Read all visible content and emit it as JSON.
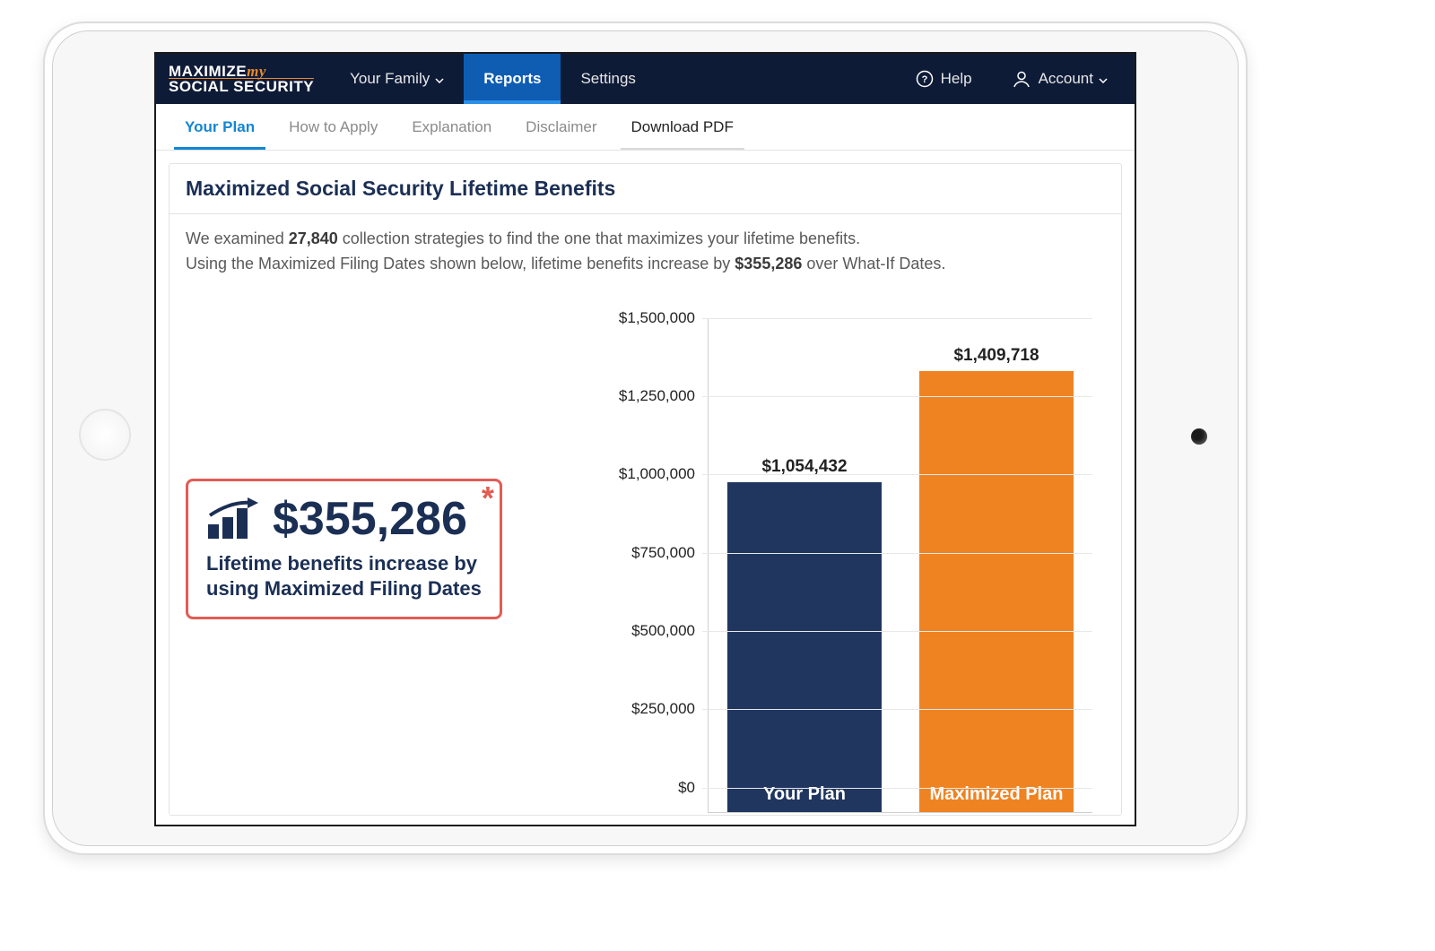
{
  "brand": {
    "maximize": "MAXIMIZE",
    "my": "my",
    "line2": "SOCIAL SECURITY"
  },
  "nav": {
    "your_family": "Your Family",
    "reports": "Reports",
    "settings": "Settings",
    "help": "Help",
    "account": "Account"
  },
  "subtabs": {
    "your_plan": "Your Plan",
    "how_to_apply": "How to Apply",
    "explanation": "Explanation",
    "disclaimer": "Disclaimer",
    "download_pdf": "Download PDF"
  },
  "panel": {
    "title": "Maximized Social Security Lifetime Benefits",
    "summary_1a": "We examined ",
    "summary_1b": "27,840",
    "summary_1c": " collection strategies to find the one that maximizes your lifetime benefits.",
    "summary_2a": "Using the Maximized Filing Dates shown below, lifetime benefits increase by ",
    "summary_2b": "$355,286",
    "summary_2c": " over What-If Dates."
  },
  "callout": {
    "amount": "$355,286",
    "line1": "Lifetime benefits increase by",
    "line2": "using Maximized Filing Dates"
  },
  "chart_data": {
    "type": "bar",
    "categories": [
      "Your Plan",
      "Maximized Plan"
    ],
    "values": [
      1054432,
      1409718
    ],
    "value_labels": [
      "$1,054,432",
      "$1,409,718"
    ],
    "colors": [
      "#20365f",
      "#ef8322"
    ],
    "ylim": [
      0,
      1500000
    ],
    "ytick_step": 250000,
    "ytick_labels": [
      "$0",
      "$250,000",
      "$500,000",
      "$750,000",
      "$1,000,000",
      "$1,250,000",
      "$1,500,000"
    ],
    "title": "",
    "xlabel": "",
    "ylabel": ""
  }
}
